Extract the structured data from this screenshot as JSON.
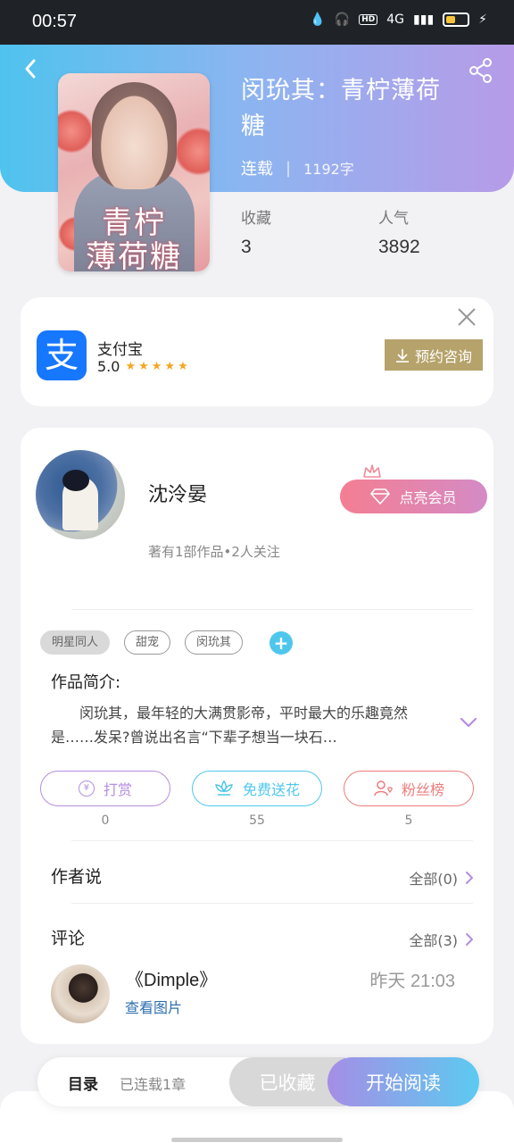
{
  "status_bar": {
    "time": "00:57",
    "network": "4G",
    "hd": "HD"
  },
  "header": {
    "back_icon": "chevron-left-icon",
    "share_icon": "share-icon"
  },
  "book": {
    "cover_title_line1": "青柠",
    "cover_title_line2": "薄荷糖",
    "title": "闵玧其：青柠薄荷糖",
    "status": "连载",
    "words": "1192字",
    "favorites_label": "收藏",
    "favorites_value": "3",
    "popularity_label": "人气",
    "popularity_value": "3892"
  },
  "ad": {
    "app_logo_char": "支",
    "app_name": "支付宝",
    "rating": "5.0",
    "stars": "★★★★★",
    "button_label": "预约咨询"
  },
  "author": {
    "name": "沈泠晏",
    "stats": "著有1部作品•2人关注",
    "vip_label": "点亮会员"
  },
  "tags": [
    "明星同人",
    "甜宠",
    "闵玧其"
  ],
  "intro": {
    "label": "作品简介:",
    "text": "闵玧其，最年轻的大满贯影帝，平时最大的乐趣竟然是……发呆?曾说出名言“下辈子想当一块石…"
  },
  "actions": [
    {
      "label": "打赏",
      "count": "0",
      "color": "#b58ee0",
      "icon": "yen-icon"
    },
    {
      "label": "免费送花",
      "count": "55",
      "color": "#4fc7ec",
      "icon": "flower-icon"
    },
    {
      "label": "粉丝榜",
      "count": "5",
      "color": "#ef7b7b",
      "icon": "fan-icon"
    }
  ],
  "author_says": {
    "label": "作者说",
    "all": "全部(0)"
  },
  "comments": {
    "label": "评论",
    "all": "全部(3)",
    "first": {
      "title": "《Dimple》",
      "link": "查看图片",
      "time": "昨天 21:03"
    }
  },
  "bottom_bar": {
    "toc": "目录",
    "toc_sub": "已连载1章",
    "favorited": "已收藏",
    "start_reading": "开始阅读"
  }
}
